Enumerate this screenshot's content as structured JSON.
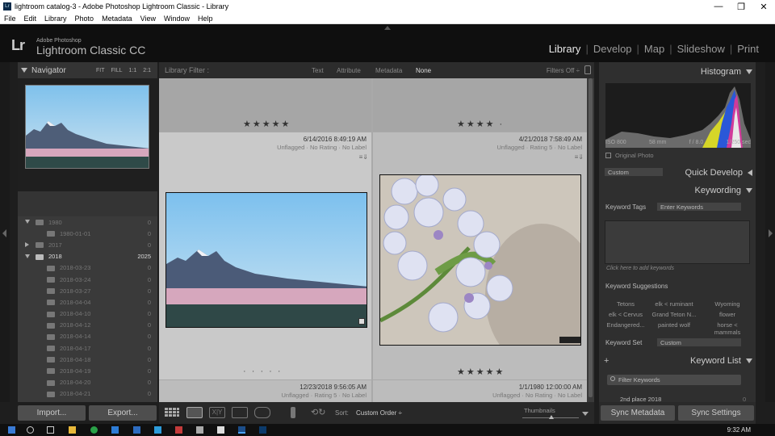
{
  "window": {
    "title": "lightroom catalog-3 - Adobe Photoshop Lightroom Classic - Library",
    "app_icon": "Lr"
  },
  "menu": [
    "File",
    "Edit",
    "Library",
    "Photo",
    "Metadata",
    "View",
    "Window",
    "Help"
  ],
  "identity": {
    "logo": "Lr",
    "brand_line1": "Adobe Photoshop",
    "brand_line2": "Lightroom Classic CC"
  },
  "modules": {
    "library": "Library",
    "develop": "Develop",
    "map": "Map",
    "slideshow": "Slideshow",
    "print": "Print",
    "active": "Library"
  },
  "navigator": {
    "title": "Navigator",
    "options": [
      "FIT",
      "FILL",
      "1:1",
      "2:1"
    ]
  },
  "folders": [
    {
      "name": "1980",
      "count": "0",
      "level": 1,
      "expanded": true
    },
    {
      "name": "1980-01-01",
      "count": "0",
      "level": 2
    },
    {
      "name": "2017",
      "count": "0",
      "level": 1,
      "expanded": false
    },
    {
      "name": "2018",
      "count": "2025",
      "level": 1,
      "expanded": true,
      "bright": true
    },
    {
      "name": "2018-03-23",
      "count": "0",
      "level": 2
    },
    {
      "name": "2018-03-24",
      "count": "0",
      "level": 2
    },
    {
      "name": "2018-03-27",
      "count": "0",
      "level": 2
    },
    {
      "name": "2018-04-04",
      "count": "0",
      "level": 2
    },
    {
      "name": "2018-04-10",
      "count": "0",
      "level": 2
    },
    {
      "name": "2018-04-12",
      "count": "0",
      "level": 2
    },
    {
      "name": "2018-04-14",
      "count": "0",
      "level": 2
    },
    {
      "name": "2018-04-17",
      "count": "0",
      "level": 2
    },
    {
      "name": "2018-04-18",
      "count": "0",
      "level": 2
    },
    {
      "name": "2018-04-19",
      "count": "0",
      "level": 2
    },
    {
      "name": "2018-04-20",
      "count": "0",
      "level": 2
    },
    {
      "name": "2018-04-21",
      "count": "0",
      "level": 2
    }
  ],
  "left_buttons": {
    "import": "Import...",
    "export": "Export..."
  },
  "filter": {
    "label": "Library Filter :",
    "options": [
      "Text",
      "Attribute",
      "Metadata",
      "None"
    ],
    "selected": "None",
    "filters_off": "Filters Off ÷"
  },
  "grid": {
    "top_stars": [
      "★★★★★",
      "★★★★ ·"
    ],
    "cells": [
      {
        "date": "6/14/2016 8:49:19 AM",
        "flag": "Unflagged · No Rating · No Label",
        "stars": "· · · · ·"
      },
      {
        "date": "4/21/2018 7:58:49 AM",
        "flag": "Unflagged · Rating 5 · No Label",
        "stars": "★★★★★"
      },
      {
        "date": "12/23/2018 9:56:05 AM",
        "flag": "Unflagged · Rating 5 · No Label"
      },
      {
        "date": "1/1/1980 12:00:00 AM",
        "flag": "Unflagged · No Rating · No Label"
      }
    ]
  },
  "toolbar": {
    "sort_label": "Sort:",
    "sort_value": "Custom Order ÷",
    "thumbnails_label": "Thumbnails"
  },
  "histogram": {
    "title": "Histogram",
    "iso": "ISO 800",
    "focal": "58 mm",
    "aperture": "f / 8.0",
    "shutter": "1/250 sec",
    "original_photo": "Original Photo"
  },
  "quick_develop": {
    "title": "Quick Develop",
    "preset": "Custom"
  },
  "keywording": {
    "title": "Keywording",
    "tags_label": "Keyword Tags",
    "tags_value": "Enter Keywords",
    "add_hint": "Click here to add keywords",
    "suggestions_label": "Keyword Suggestions",
    "suggestions": [
      "Tetons",
      "elk < ruminant",
      "Wyoming",
      "elk < Cervus",
      "Grand Teton N...",
      "flower",
      "Endangered...",
      "painted wolf",
      "horse < mammals"
    ],
    "set_label": "Keyword Set",
    "set_value": "Custom"
  },
  "keyword_list": {
    "title": "Keyword List",
    "add": "+",
    "filter_placeholder": "Filter Keywords",
    "first_item": "2nd place 2018",
    "first_count": "0"
  },
  "sync": {
    "metadata": "Sync Metadata",
    "settings": "Sync Settings"
  },
  "taskbar": {
    "time": "9:32 AM"
  },
  "colors": {
    "accent_active": "#e8e8e8",
    "panel_bg": "#343434",
    "grid_bg": "#a9a9a9"
  }
}
